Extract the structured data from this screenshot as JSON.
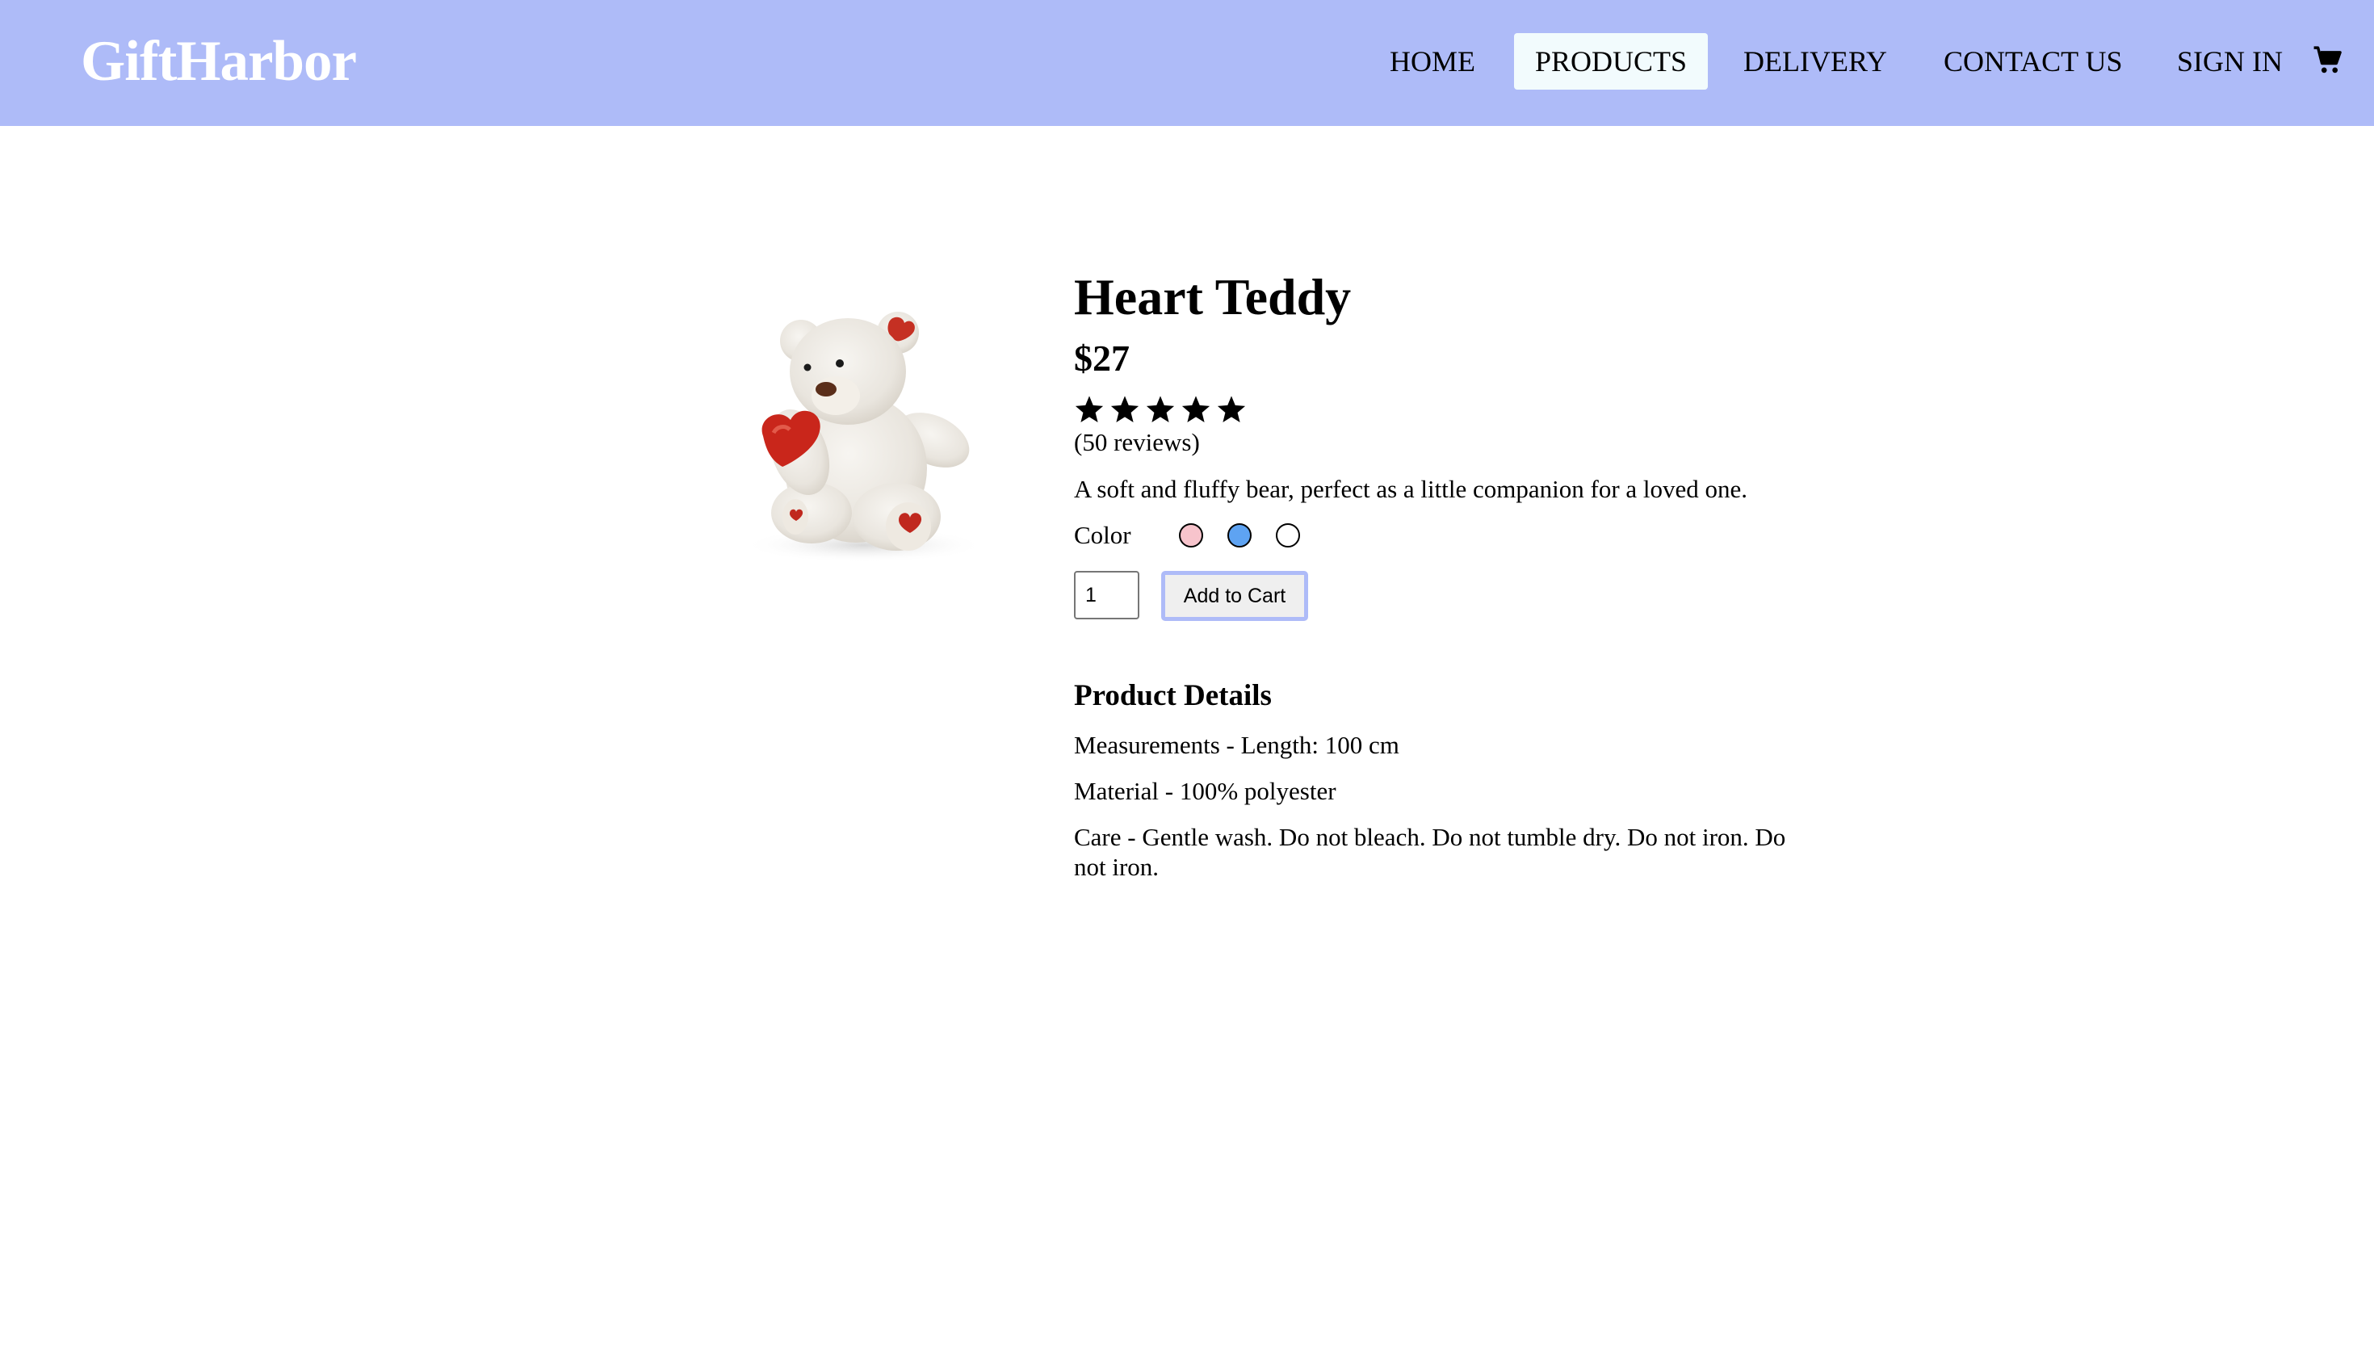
{
  "brand": {
    "name": "GiftHarbor",
    "color": "#aebbf8"
  },
  "nav": {
    "items": [
      {
        "label": "HOME"
      },
      {
        "label": "PRODUCTS",
        "active": true
      },
      {
        "label": "DELIVERY"
      },
      {
        "label": "CONTACT US"
      },
      {
        "label": "SIGN IN"
      }
    ],
    "cart_icon": "shopping-cart-icon"
  },
  "product": {
    "image_icon": "teddy-bear-with-hearts",
    "title": "Heart Teddy",
    "price": "$27",
    "rating": 5,
    "rating_max": 5,
    "reviews": "(50 reviews)",
    "description": "A soft and fluffy bear, perfect as a little companion for a loved one.",
    "color_label": "Color",
    "colors": [
      {
        "name": "pink",
        "hex": "#f7c4cc"
      },
      {
        "name": "blue",
        "hex": "#5ea3f2"
      },
      {
        "name": "white",
        "hex": "#ffffff"
      }
    ],
    "quantity": "1",
    "add_to_cart": "Add to Cart"
  },
  "details": {
    "title": "Product Details",
    "measurements": "Measurements - Length: 100 cm",
    "material": "Material - 100% polyester",
    "care": "Care - Gentle wash. Do not bleach. Do not tumble dry. Do not iron. Do not iron."
  }
}
